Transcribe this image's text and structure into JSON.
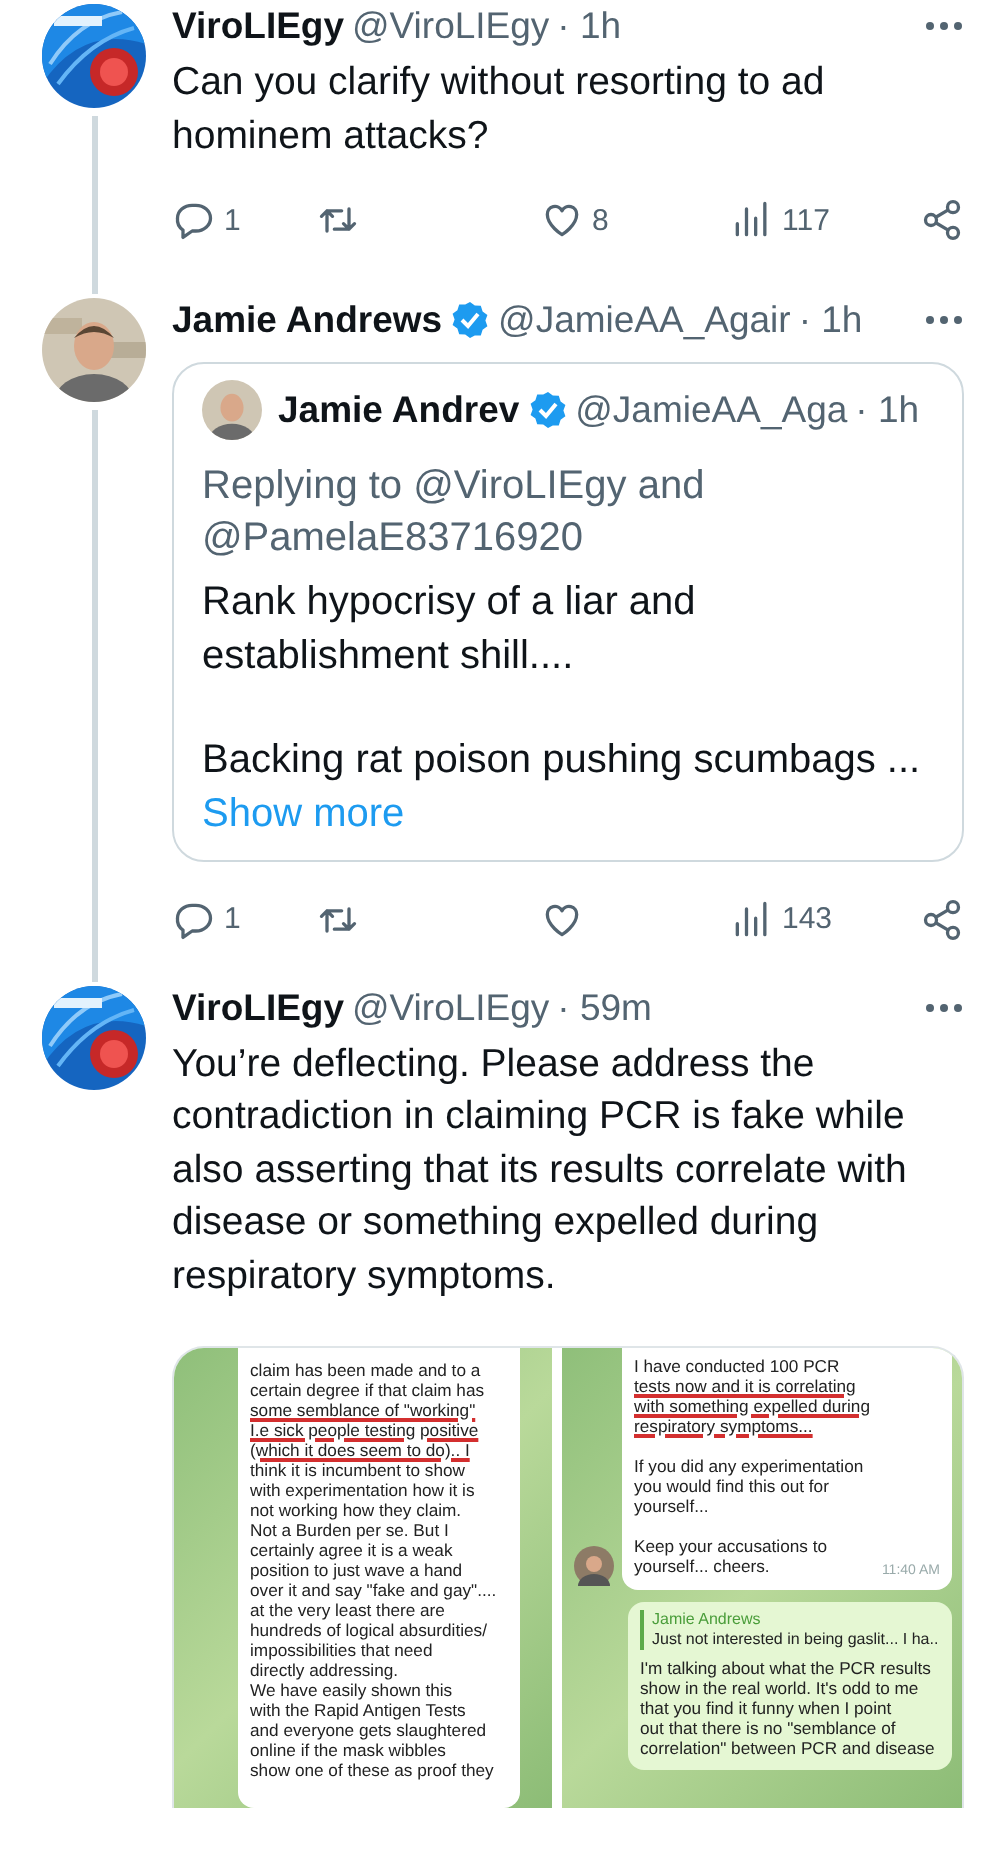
{
  "tweets": [
    {
      "avatar": {
        "kind": "logo"
      },
      "author": "ViroLIEgy",
      "verified": false,
      "handle": "@ViroLIEgy",
      "time": "· 1h",
      "paragraphs": [
        "Can you clarify without resorting to ad hominem attacks?"
      ],
      "actions": {
        "replies": "1",
        "likes": "8",
        "views": "117"
      }
    },
    {
      "avatar": {
        "kind": "person"
      },
      "author": "Jamie Andrews",
      "verified": true,
      "handle": "@JamieAA_Agair",
      "time": "· 1h",
      "quote": {
        "avatar": {
          "kind": "person"
        },
        "author": "Jamie Andrev",
        "verified": true,
        "handle": "@JamieAA_Aga",
        "time": "· 1h",
        "replying": "Replying to @ViroLIEgy and @PamelaE83716920",
        "paragraphs": [
          "Rank hypocrisy of a liar and establishment shill....",
          "Backing rat poison pushing scumbags ..."
        ],
        "show_more": "Show more"
      },
      "actions": {
        "replies": "1",
        "views": "143"
      }
    },
    {
      "avatar": {
        "kind": "logo"
      },
      "author": "ViroLIEgy",
      "verified": false,
      "handle": "@ViroLIEgy",
      "time": "· 59m",
      "paragraphs": [
        "You’re deflecting. Please address the contradiction in claiming PCR is fake while also asserting that its results correlate with disease or something expelled during respiratory symptoms."
      ],
      "media": {
        "kind": "chat_screenshots",
        "panels": [
          {
            "bubbles": [
              {
                "kind": "incoming",
                "avatar": false,
                "paragraphs": [
                  [
                    {
                      "text": "claim has been made and to a",
                      "underlined": false
                    },
                    {
                      "text": "certain degree if that claim has",
                      "underlined": false
                    },
                    {
                      "text": "some semblance of \"working\"",
                      "underlined": true
                    },
                    {
                      "text": "I.e sick people testing positive",
                      "underlined": true
                    },
                    {
                      "text": "(which it does seem to do).. I",
                      "underlined": true
                    },
                    {
                      "text": "think it is incumbent to show",
                      "underlined": false
                    },
                    {
                      "text": "with experimentation how it is",
                      "underlined": false
                    },
                    {
                      "text": "not working how they claim.",
                      "underlined": false
                    },
                    {
                      "text": "Not a Burden per se. But I",
                      "underlined": false
                    },
                    {
                      "text": "certainly agree it is a weak",
                      "underlined": false
                    },
                    {
                      "text": "position to just wave a hand",
                      "underlined": false
                    },
                    {
                      "text": "over it and say \"fake and gay\"....",
                      "underlined": false
                    },
                    {
                      "text": "at the very least there are",
                      "underlined": false
                    },
                    {
                      "text": "hundreds of logical absurdities/",
                      "underlined": false
                    },
                    {
                      "text": "impossibilities that need",
                      "underlined": false
                    },
                    {
                      "text": "directly addressing.",
                      "underlined": false
                    },
                    {
                      "text": "We have easily shown this",
                      "underlined": false
                    },
                    {
                      "text": "with the Rapid Antigen Tests",
                      "underlined": false
                    },
                    {
                      "text": "and everyone gets slaughtered",
                      "underlined": false
                    },
                    {
                      "text": "online if the mask wibbles",
                      "underlined": false
                    },
                    {
                      "text": "show one of these as proof they",
                      "underlined": false
                    }
                  ]
                ]
              }
            ]
          },
          {
            "bubbles": [
              {
                "kind": "incoming",
                "avatar": true,
                "time": "11:40 AM",
                "paragraphs": [
                  [
                    {
                      "text": "I have conducted 100 PCR",
                      "underlined": false
                    },
                    {
                      "text": "tests now and it is correlating",
                      "underlined": true
                    },
                    {
                      "text": "with something expelled during",
                      "underlined": true
                    },
                    {
                      "text": "respiratory symptoms...",
                      "underlined": true
                    }
                  ],
                  [
                    {
                      "text": "If you did any experimentation",
                      "underlined": false
                    },
                    {
                      "text": "you would find this out for",
                      "underlined": false
                    },
                    {
                      "text": "yourself...",
                      "underlined": false
                    }
                  ],
                  [
                    {
                      "text": "Keep your accusations to",
                      "underlined": false
                    },
                    {
                      "text": "yourself... cheers.",
                      "underlined": false
                    }
                  ]
                ]
              },
              {
                "kind": "outgoing",
                "avatar": false,
                "reply": {
                  "author": "Jamie Andrews",
                  "text": "Just not interested in being gaslit... I ha.."
                },
                "paragraphs": [
                  [
                    {
                      "text": "I'm talking about what the PCR results",
                      "underlined": false
                    },
                    {
                      "text": "show in the real world. It's odd to me",
                      "underlined": false
                    },
                    {
                      "text": "that you find it funny when I point",
                      "underlined": false
                    },
                    {
                      "text": "out that there is no \"semblance of",
                      "underlined": false
                    },
                    {
                      "text": "correlation\" between PCR and disease",
                      "underlined": false
                    }
                  ]
                ]
              }
            ]
          }
        ]
      }
    }
  ]
}
